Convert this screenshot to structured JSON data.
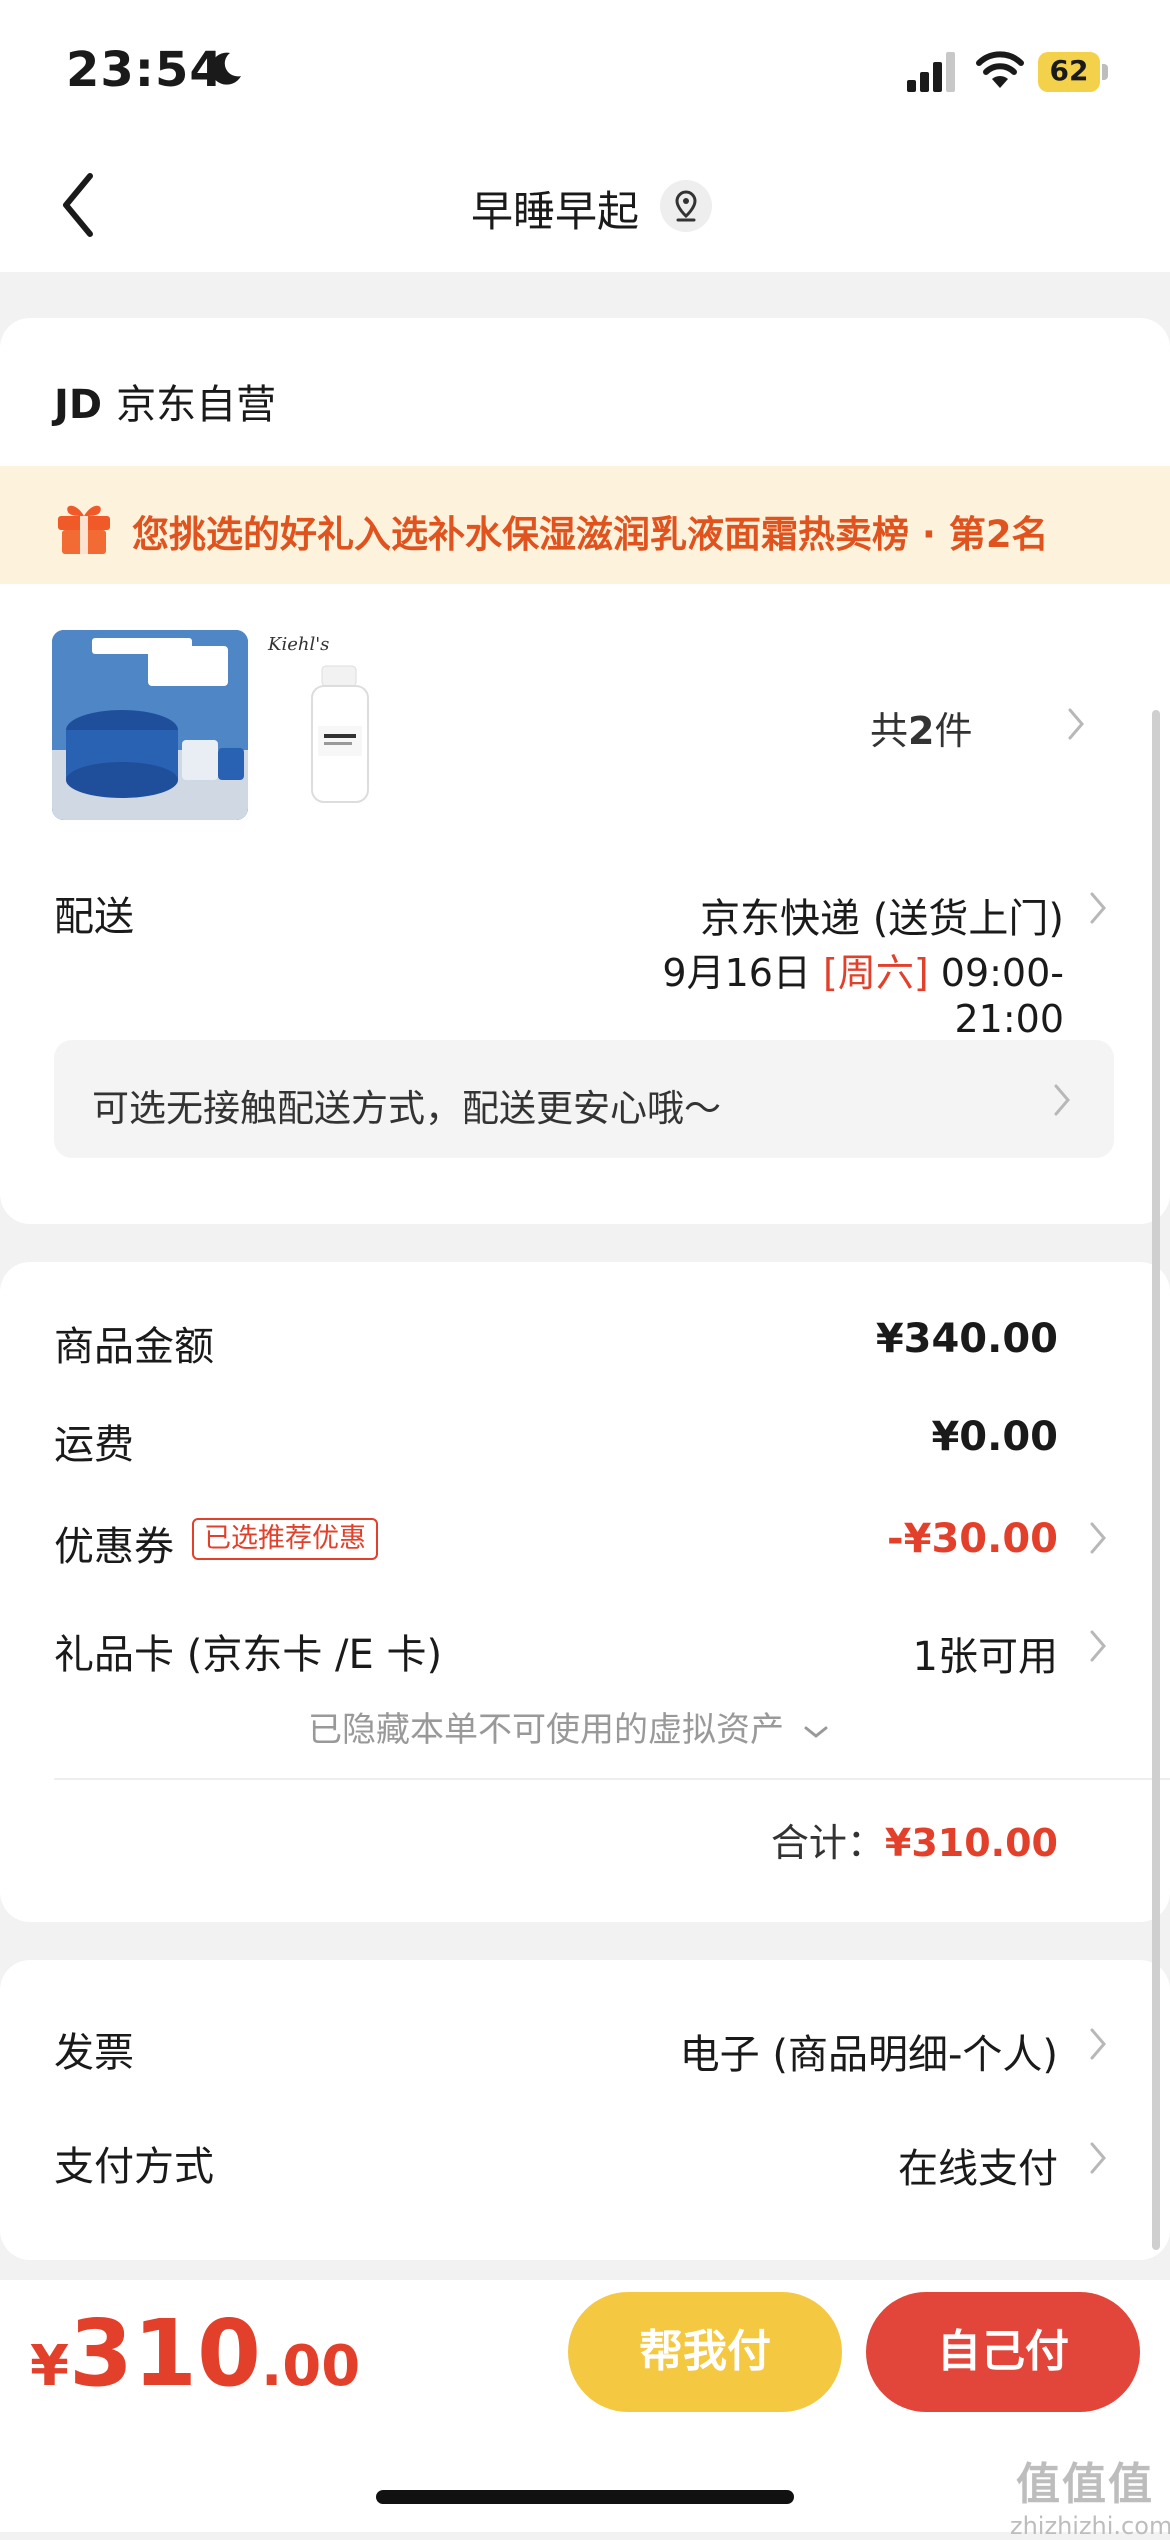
{
  "status": {
    "time": "23:54",
    "battery": "62"
  },
  "nav": {
    "title": "早睡早起"
  },
  "shop": {
    "logo": "JD",
    "name": "京东自营"
  },
  "banner": {
    "text": "您挑选的好礼入选补水保湿滋润乳液面霜热卖榜 · 第2名"
  },
  "products": {
    "count_prefix": "共",
    "count": "2",
    "count_suffix": "件",
    "brand_logo": "Kiehl's"
  },
  "delivery": {
    "label": "配送",
    "method": "京东快递 (送货上门)",
    "date": "9月16日",
    "weekday": "[周六]",
    "time": "09:00-21:00",
    "notice": "可选无接触配送方式，配送更安心哦～"
  },
  "price": {
    "goods_label": "商品金额",
    "goods_value": "¥340.00",
    "shipping_label": "运费",
    "shipping_value": "¥0.00",
    "coupon_label": "优惠券",
    "coupon_tag": "已选推荐优惠",
    "coupon_value": "-¥30.00",
    "giftcard_label": "礼品卡 (京东卡 /E 卡)",
    "giftcard_value": "1张可用",
    "hidden_assets": "已隐藏本单不可使用的虚拟资产",
    "total_label": "合计：",
    "total_value": "¥310.00"
  },
  "invoice": {
    "label": "发票",
    "value": "电子 (商品明细-个人)"
  },
  "payment": {
    "label": "支付方式",
    "value": "在线支付"
  },
  "bottom": {
    "currency": "¥",
    "amount_int": "310",
    "amount_dec": ".00",
    "help_pay": "帮我付",
    "self_pay": "自己付"
  },
  "watermark": {
    "text": "值值值",
    "url": "zhizhizhi.com"
  },
  "colors": {
    "accent_red": "#e2402b",
    "help_yellow": "#f5c842",
    "banner_bg": "#fdf3dc"
  }
}
